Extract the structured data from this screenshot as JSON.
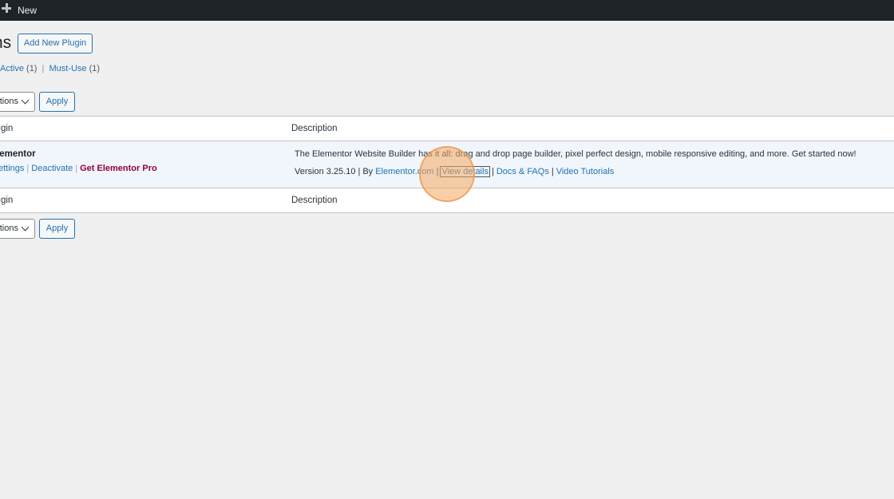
{
  "adminbar": {
    "new_label": "New"
  },
  "page": {
    "title": "ns",
    "add_new_label": "Add New Plugin"
  },
  "filters": {
    "active_label": "Active",
    "active_count": "(1)",
    "separator": "|",
    "mustuse_label": "Must-Use",
    "mustuse_count": "(1)"
  },
  "bulk_top": {
    "select_value": "tions",
    "apply_label": "Apply"
  },
  "bulk_bottom": {
    "select_value": "tions",
    "apply_label": "Apply"
  },
  "table": {
    "col_plugin": "lugin",
    "col_description": "Description",
    "rows": [
      {
        "name": "lementor",
        "actions": {
          "settings": "ettings",
          "deactivate": "Deactivate",
          "get_pro": "Get Elementor Pro",
          "sep": "|"
        },
        "description": "The Elementor Website Builder has it all: drag and drop page builder, pixel perfect design, mobile responsive editing, and more. Get started now!",
        "version_text": "Version 3.25.10",
        "by_text": "By",
        "author": "Elementor.com",
        "view_details": "View details",
        "docs": "Docs & FAQs",
        "tutorials": "Video Tutorials",
        "sep": "|"
      }
    ]
  },
  "colors": {
    "accent": "#2271b1",
    "pro": "#93003c",
    "adminbar": "#1d2327",
    "click_highlight": "#f6a860"
  }
}
